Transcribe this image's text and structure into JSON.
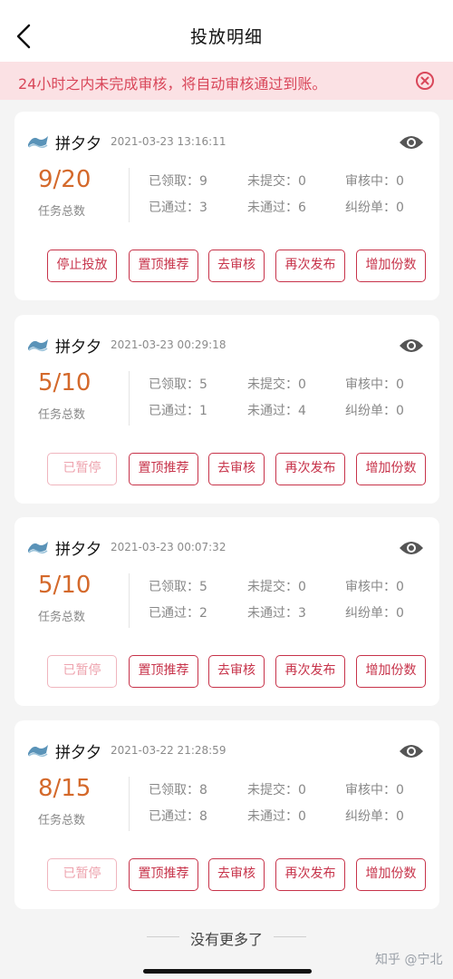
{
  "header": {
    "title": "投放明细",
    "back_icon": "chevron-left-icon"
  },
  "notice": {
    "text": "24小时之内未完成审核，将自动审核通过到账。",
    "color": "#d9475a",
    "close_icon": "close-circle-icon"
  },
  "stat_labels": {
    "received": "已领取：",
    "unsubmitted": "未提交：",
    "reviewing": "审核中：",
    "passed": "已通过：",
    "failed": "未通过：",
    "dispute": "纠纷单："
  },
  "total_label": "任务总数",
  "buttons": {
    "stop": "停止投放",
    "paused": "已暂停",
    "top": "置顶推荐",
    "review": "去审核",
    "republish": "再次发布",
    "add": "增加份数"
  },
  "cards": [
    {
      "name": "拼夕夕",
      "time": "2021-03-23 13:16:11",
      "total": "9/20",
      "received": "9",
      "unsubmitted": "0",
      "reviewing": "0",
      "passed": "3",
      "failed": "6",
      "dispute": "0",
      "status_button": "停止投放",
      "status_disabled": false
    },
    {
      "name": "拼夕夕",
      "time": "2021-03-23 00:29:18",
      "total": "5/10",
      "received": "5",
      "unsubmitted": "0",
      "reviewing": "0",
      "passed": "1",
      "failed": "4",
      "dispute": "0",
      "status_button": "已暂停",
      "status_disabled": true
    },
    {
      "name": "拼夕夕",
      "time": "2021-03-23 00:07:32",
      "total": "5/10",
      "received": "5",
      "unsubmitted": "0",
      "reviewing": "0",
      "passed": "2",
      "failed": "3",
      "dispute": "0",
      "status_button": "已暂停",
      "status_disabled": true
    },
    {
      "name": "拼夕夕",
      "time": "2021-03-22 21:28:59",
      "total": "8/15",
      "received": "8",
      "unsubmitted": "0",
      "reviewing": "0",
      "passed": "8",
      "failed": "0",
      "dispute": "0",
      "status_button": "已暂停",
      "status_disabled": true
    }
  ],
  "footer": {
    "text": "没有更多了"
  },
  "watermark": "知乎 @宁北",
  "colors": {
    "accent": "#c7334a",
    "total": "#d4692b",
    "notice_bg": "#fbe1e4"
  }
}
